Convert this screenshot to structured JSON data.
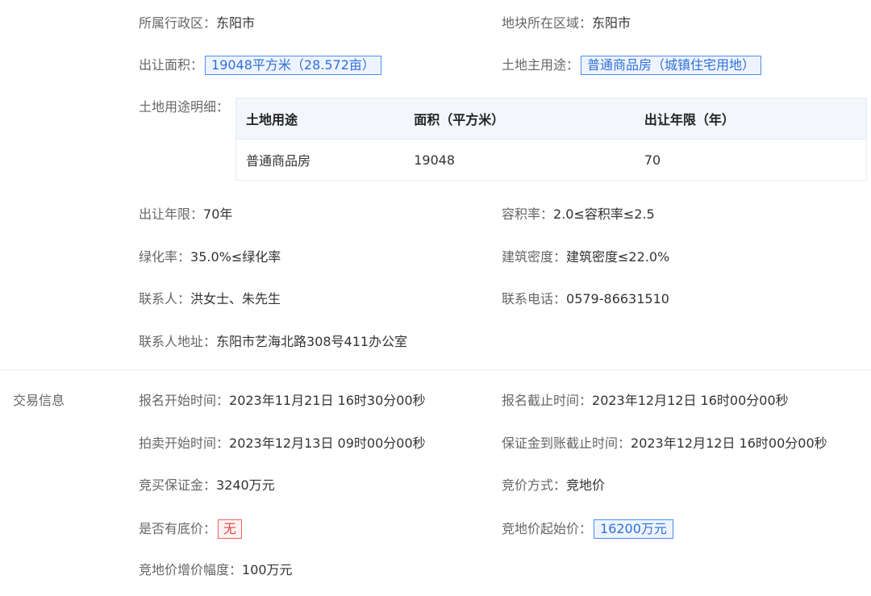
{
  "land_info": {
    "district": {
      "label": "所属行政区：",
      "value": "东阳市"
    },
    "region": {
      "label": "地块所在区域：",
      "value": "东阳市"
    },
    "area": {
      "label": "出让面积：",
      "value": "19048平方米（28.572亩）"
    },
    "main_use": {
      "label": "土地主用途：",
      "value": "普通商品房（城镇住宅用地）"
    },
    "use_detail_label": "土地用途明细：",
    "use_table": {
      "headers": [
        "土地用途",
        "面积（平方米）",
        "出让年限（年）"
      ],
      "rows": [
        [
          "普通商品房",
          "19048",
          "70"
        ]
      ]
    },
    "term": {
      "label": "出让年限：",
      "value": "70年"
    },
    "plot_ratio": {
      "label": "容积率：",
      "value": "2.0≤容积率≤2.5"
    },
    "green_rate": {
      "label": "绿化率：",
      "value": "35.0%≤绿化率"
    },
    "building_density": {
      "label": "建筑密度：",
      "value": "建筑密度≤22.0%"
    },
    "contact": {
      "label": "联系人：",
      "value": "洪女士、朱先生"
    },
    "phone": {
      "label": "联系电话：",
      "value": "0579-86631510"
    },
    "address": {
      "label": "联系人地址：",
      "value": "东阳市艺海北路308号411办公室"
    }
  },
  "transaction": {
    "section_label": "交易信息",
    "signup_start": {
      "label": "报名开始时间：",
      "value": "2023年11月21日 16时30分00秒"
    },
    "signup_end": {
      "label": "报名截止时间：",
      "value": "2023年12月12日 16时00分00秒"
    },
    "auction_start": {
      "label": "拍卖开始时间：",
      "value": "2023年12月13日 09时00分00秒"
    },
    "deposit_deadline": {
      "label": "保证金到账截止时间：",
      "value": "2023年12月12日 16时00分00秒"
    },
    "deposit": {
      "label": "竞买保证金：",
      "value": "3240万元"
    },
    "bid_method": {
      "label": "竞价方式：",
      "value": "竞地价"
    },
    "reserve_price": {
      "label": "是否有底价：",
      "value": "无"
    },
    "start_price": {
      "label": "竞地价起始价：",
      "value": "16200万元"
    },
    "increment": {
      "label": "竞地价增价幅度：",
      "value": "100万元"
    }
  },
  "colors": {
    "tag_blue_border": "#4b8df8",
    "tag_red_border": "#f26060",
    "label_gray": "#666666"
  }
}
